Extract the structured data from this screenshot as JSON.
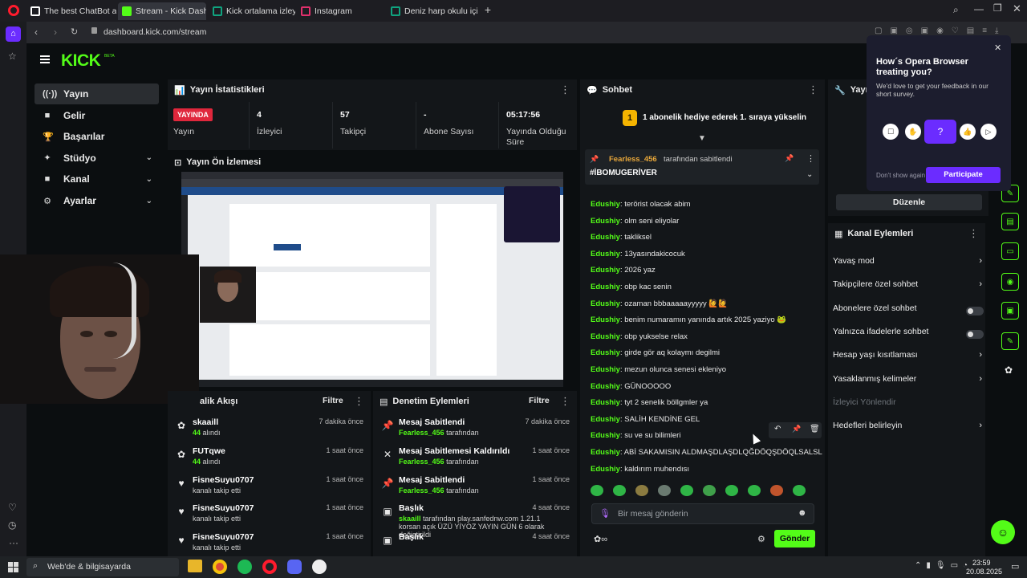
{
  "browser": {
    "tabs": [
      {
        "label": "The best ChatBot and Wi",
        "color": "#ffffff"
      },
      {
        "label": "Stream - Kick Dashboard",
        "color": "#53fc18"
      },
      {
        "label": "Kick ortalama izleyiciyi na",
        "color": "#10a37f"
      },
      {
        "label": "Instagram",
        "color": "#e1306c"
      },
      {
        "label": "Deniz harp okulu için TYT",
        "color": "#10a37f"
      }
    ],
    "url": "dashboard.kick.com/stream"
  },
  "kick": {
    "logo": "KICK",
    "logo_beta": "BETA"
  },
  "nav": [
    {
      "label": "Yayın",
      "icon": "broadcast-icon",
      "glyph": "((·))",
      "active": true,
      "chev": false
    },
    {
      "label": "Gelir",
      "icon": "money-icon",
      "glyph": "■",
      "active": false,
      "chev": false
    },
    {
      "label": "Başarılar",
      "icon": "trophy-icon",
      "glyph": "🏆",
      "active": false,
      "chev": false
    },
    {
      "label": "Stüdyo",
      "icon": "studio-icon",
      "glyph": "✦",
      "active": false,
      "chev": true
    },
    {
      "label": "Kanal",
      "icon": "channel-icon",
      "glyph": "■",
      "active": false,
      "chev": true
    },
    {
      "label": "Ayarlar",
      "icon": "gear-icon",
      "glyph": "⚙",
      "active": false,
      "chev": true
    }
  ],
  "stats": {
    "title": "Yayın İstatistikleri",
    "live_badge": "YAYINDA",
    "items": [
      {
        "value": "",
        "label": "Yayın"
      },
      {
        "value": "4",
        "label": "İzleyici"
      },
      {
        "value": "57",
        "label": "Takipçi"
      },
      {
        "value": "-",
        "label": "Abone Sayısı"
      },
      {
        "value": "05:17:56",
        "label": "Yayında Olduğu Süre"
      }
    ]
  },
  "preview": {
    "title": "Yayın Ön İzlemesi"
  },
  "activity": {
    "title": "alik Akışı",
    "filter": "Filtre",
    "rows": [
      {
        "icon": "kick-icon",
        "glyph": "✿",
        "name": "skaaill",
        "sub_bold": "44",
        "sub": " alındı",
        "time": "7 dakika önce"
      },
      {
        "icon": "kick-icon",
        "glyph": "✿",
        "name": "FUTqwe",
        "sub_bold": "44",
        "sub": " alındı",
        "time": "1 saat önce"
      },
      {
        "icon": "heart-icon",
        "glyph": "♥",
        "name": "FisneSuyu0707",
        "sub_bold": "",
        "sub": "kanalı takip etti",
        "time": "1 saat önce"
      },
      {
        "icon": "heart-icon",
        "glyph": "♥",
        "name": "FisneSuyu0707",
        "sub_bold": "",
        "sub": "kanalı takip etti",
        "time": "1 saat önce"
      },
      {
        "icon": "heart-icon",
        "glyph": "♥",
        "name": "FisneSuyu0707",
        "sub_bold": "",
        "sub": "kanalı takip etti",
        "time": "1 saat önce"
      }
    ]
  },
  "moderation": {
    "title": "Denetim Eylemleri",
    "filter": "Filtre",
    "rows": [
      {
        "icon": "pin-icon",
        "glyph": "📌",
        "name": "Mesaj Sabitlendi",
        "sub_bold": "Fearless_456",
        "sub": " tarafından",
        "time": "7 dakika önce"
      },
      {
        "icon": "unpin-icon",
        "glyph": "✕",
        "name": "Mesaj Sabitlemesi Kaldırıldı",
        "sub_bold": "Fearless_456",
        "sub": " tarafından",
        "time": "1 saat önce"
      },
      {
        "icon": "pin-icon",
        "glyph": "📌",
        "name": "Mesaj Sabitlendi",
        "sub_bold": "Fearless_456",
        "sub": " tarafından",
        "time": "1 saat önce"
      },
      {
        "icon": "title-icon",
        "glyph": "▣",
        "name": "Başlık",
        "sub_bold": "skaaill",
        "sub": " tarafından play.sanfednw.com 1.21.1 korsan açık ÜZÜ YİYOZ YAYIN GÜN 6 olarak değiştirildi",
        "time": "4 saat önce"
      },
      {
        "icon": "title-icon",
        "glyph": "▣",
        "name": "Başlık",
        "sub_bold": "",
        "sub": "",
        "time": "4 saat önce"
      }
    ]
  },
  "chat": {
    "title": "Sohbet",
    "gift_banner": "1 abonelik hediye ederek 1. sıraya yükselin",
    "gift_rank": "1",
    "pinned_by_user": "Fearless_456",
    "pinned_by_text": " tarafından sabitlendi",
    "pinned_text": "#İBOMUGERİVER",
    "messages": [
      {
        "user": "Edushiy",
        "text": "terörist olacak abim"
      },
      {
        "user": "Edushiy",
        "text": "olm seni eliyolar"
      },
      {
        "user": "Edushiy",
        "text": "takliksel"
      },
      {
        "user": "Edushiy",
        "text": "13yasındakicocuk"
      },
      {
        "user": "Edushiy",
        "text": "2026 yaz"
      },
      {
        "user": "Edushiy",
        "text": "obp kac senin"
      },
      {
        "user": "Edushiy",
        "text": "ozaman bbbaaaaayyyyy 🙋🙋"
      },
      {
        "user": "Edushiy",
        "text": "benim numaramın yanında artık 2025 yaziyo 🐸"
      },
      {
        "user": "Edushiy",
        "text": "obp yukselse relax"
      },
      {
        "user": "Edushiy",
        "text": "girde gör aq kolaymı degilmi"
      },
      {
        "user": "Edushiy",
        "text": "mezun olunca senesi ekleniyo"
      },
      {
        "user": "Edushiy",
        "text": "GÜNOOOOO"
      },
      {
        "user": "Edushiy",
        "text": "tyt 2 senelik böllgmler ya"
      },
      {
        "user": "Edushiy",
        "text": "SALİH KENDİNE GEL"
      },
      {
        "user": "Edushiy",
        "text": "su ve su bilimleri"
      },
      {
        "user": "Edushiy",
        "text": "ABİ SAKAMISIN ALDMAŞDLAŞDLQĞDÖQŞDÖQLSALSL"
      },
      {
        "user": "Edushiy",
        "text": "kaldırım muhendısı"
      }
    ],
    "input_placeholder": "Bir mesaj gönderin",
    "send": "Gönder"
  },
  "right_panel": {
    "title": "Yayın",
    "edit": "Düzenle",
    "actions_title": "Kanal Eylemleri",
    "rows": [
      {
        "label": "Yavaş mod",
        "type": "chev"
      },
      {
        "label": "Takipçilere özel sohbet",
        "type": "chev"
      },
      {
        "label": "Abonelere özel sohbet",
        "type": "toggle"
      },
      {
        "label": "Yalnızca ifadelerle sohbet",
        "type": "toggle"
      },
      {
        "label": "Hesap yaşı kısıtlaması",
        "type": "chev"
      },
      {
        "label": "Yasaklanmış kelimeler",
        "type": "chev"
      },
      {
        "label": "İzleyici Yönlendir",
        "type": "disabled"
      },
      {
        "label": "Hedefleri belirleyin",
        "type": "chev"
      }
    ]
  },
  "opera_popup": {
    "title": "How´s Opera Browser treating you?",
    "body": "We'd love to get your feedback in our short survey.",
    "dont_show": "Don't show again",
    "participate": "Participate"
  },
  "taskbar": {
    "search": "Web'de & bilgisayarda",
    "time": "23:59",
    "date": "20.08.2025"
  },
  "colors": {
    "kick_green": "#53fc18",
    "live_red": "#e0273c",
    "opera_purple": "#6b2cff"
  }
}
